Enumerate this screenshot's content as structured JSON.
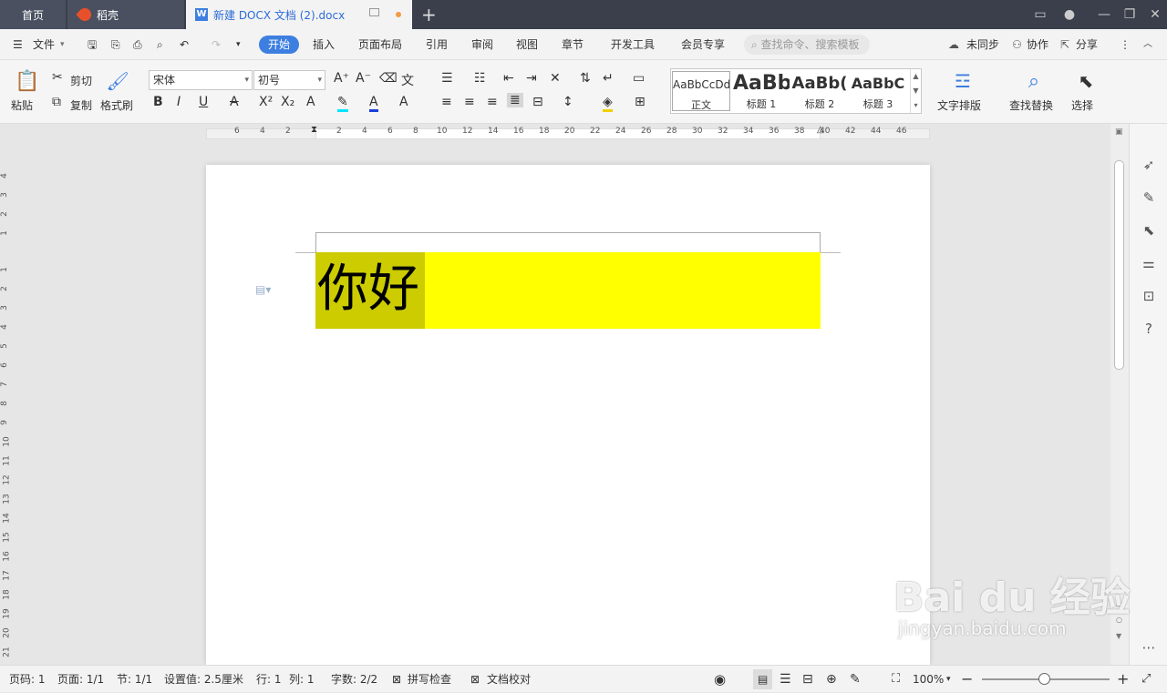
{
  "tabs": {
    "home": "首页",
    "daoke": "稻壳",
    "doc": "新建 DOCX 文档 (2).docx",
    "add": "+"
  },
  "menu": {
    "file": "文件",
    "items": [
      "开始",
      "插入",
      "页面布局",
      "引用",
      "审阅",
      "视图",
      "章节",
      "开发工具",
      "会员专享"
    ],
    "search_placeholder": "查找命令、搜索模板",
    "unsync": "未同步",
    "collab": "协作",
    "share": "分享"
  },
  "ribbon": {
    "paste": "粘贴",
    "cut": "剪切",
    "copy": "复制",
    "format_painter": "格式刷",
    "font_name": "宋体",
    "font_size": "初号",
    "styles": [
      {
        "preview": "AaBbCcDd",
        "label": "正文"
      },
      {
        "preview": "AaBb",
        "label": "标题 1"
      },
      {
        "preview": "AaBb(",
        "label": "标题 2"
      },
      {
        "preview": "AaBbC",
        "label": "标题 3"
      }
    ],
    "text_layout": "文字排版",
    "find_replace": "查找替换",
    "select": "选择"
  },
  "ruler": {
    "h_ticks": [
      "6",
      "4",
      "2",
      "2",
      "4",
      "6",
      "8",
      "10",
      "12",
      "14",
      "16",
      "18",
      "20",
      "22",
      "24",
      "26",
      "28",
      "30",
      "32",
      "34",
      "36",
      "38",
      "40",
      "42",
      "44",
      "46"
    ],
    "v_ticks": [
      "4",
      "3",
      "2",
      "1",
      "1",
      "2",
      "3",
      "4",
      "5",
      "6",
      "7",
      "8",
      "9",
      "10",
      "11",
      "12",
      "13",
      "14",
      "15",
      "16",
      "17",
      "18",
      "19",
      "20",
      "21"
    ]
  },
  "document": {
    "body_text": "你好",
    "highlight_color": "#ffff00",
    "selection_color": "#cccc00"
  },
  "status": {
    "page_num": "页码: 1",
    "pages": "页面: 1/1",
    "section": "节: 1/1",
    "setting": "设置值: 2.5厘米",
    "row": "行: 1",
    "col": "列: 1",
    "word_count": "字数: 2/2",
    "spell_check": "拼写检查",
    "doc_check": "文档校对",
    "zoom": "100%"
  },
  "watermark": {
    "brand": "Bai du 经验",
    "url": "jingyan.baidu.com"
  },
  "colors": {
    "accent": "#3d7fe0",
    "tabbar": "#3a3f4b"
  }
}
